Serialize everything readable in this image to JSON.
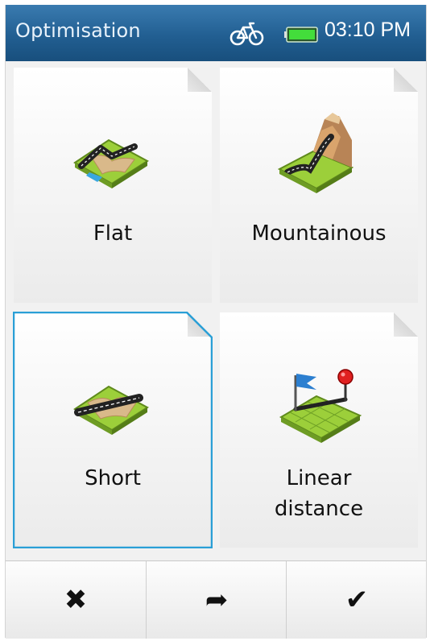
{
  "statusbar": {
    "title": "Optimisation",
    "time": "03:10 PM",
    "profile_icon": "bicycle-icon",
    "battery_icon": "battery-full-icon",
    "colors": {
      "bar": "#225f92",
      "battery": "#3fd23f"
    }
  },
  "tiles": [
    {
      "label": "Flat",
      "icon": "flat-terrain-icon",
      "selected": false
    },
    {
      "label": "Mountainous",
      "icon": "mountainous-terrain-icon",
      "selected": false
    },
    {
      "label": "Short",
      "icon": "short-route-icon",
      "selected": true
    },
    {
      "label_line1": "Linear",
      "label_line2": "distance",
      "icon": "linear-distance-icon",
      "selected": false
    }
  ],
  "toolbar": {
    "cancel_glyph": "✖",
    "next_glyph": "➦",
    "confirm_glyph": "✔",
    "icons": [
      "close-icon",
      "forward-arrow-icon",
      "checkmark-icon"
    ]
  },
  "colors": {
    "selected_border": "#2a9fd6",
    "map_green": "#9acd32",
    "road": "#333333"
  }
}
